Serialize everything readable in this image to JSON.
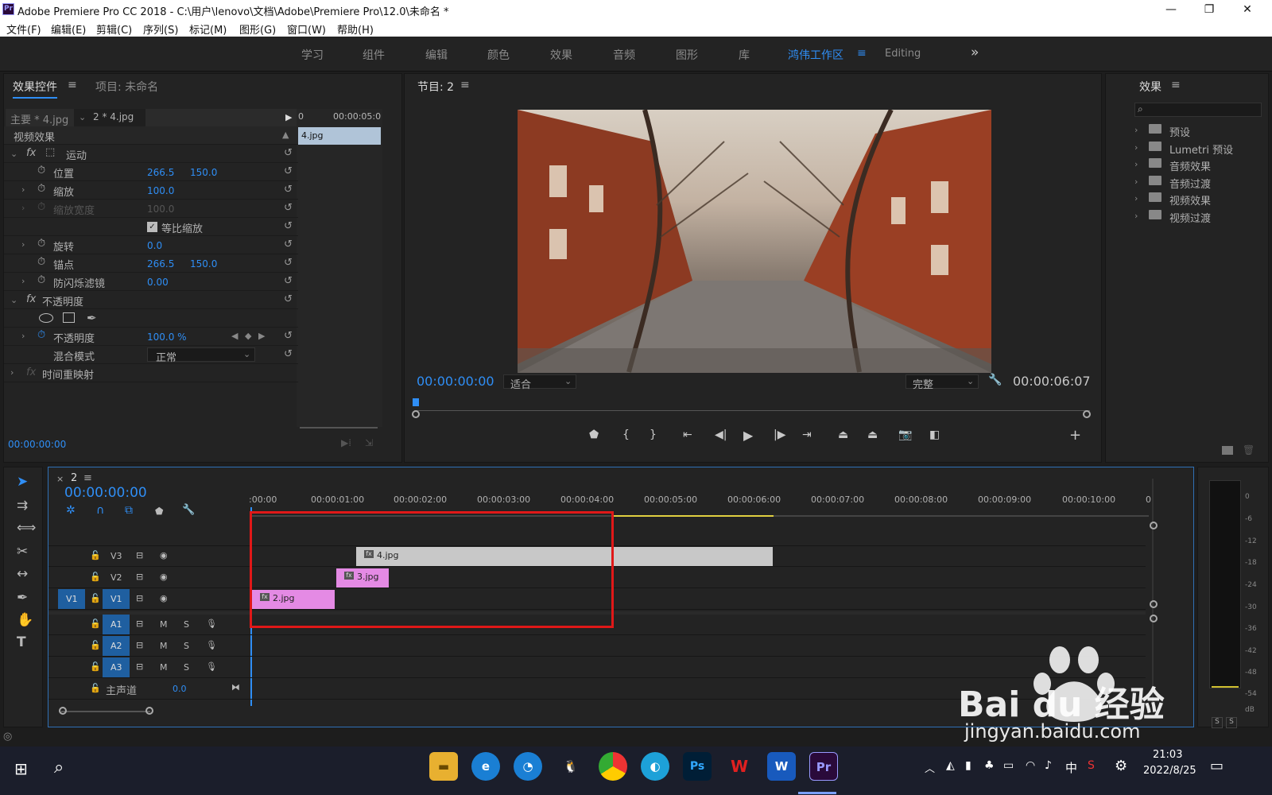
{
  "titlebar": {
    "app_icon": "Pr",
    "title": "Adobe Premiere Pro CC 2018 - C:\\用户\\lenovo\\文档\\Adobe\\Premiere Pro\\12.0\\未命名 *",
    "minimize": "—",
    "restore": "❐",
    "close": "✕"
  },
  "menu": [
    "文件(F)",
    "编辑(E)",
    "剪辑(C)",
    "序列(S)",
    "标记(M)",
    "图形(G)",
    "窗口(W)",
    "帮助(H)"
  ],
  "workspaces": [
    "学习",
    "组件",
    "编辑",
    "颜色",
    "效果",
    "音频",
    "图形",
    "库",
    "鸿伟工作区",
    "Editing"
  ],
  "workspace_active": "鸿伟工作区",
  "workspace_overflow": "»",
  "effect_controls": {
    "tab_active": "效果控件",
    "tab_menu": "≡",
    "tab_project": "项目: 未命名",
    "master": "主要 * 4.jpg",
    "clip": "2 * 4.jpg",
    "mini_time_start": "0",
    "mini_time_end": "00:00:05:0",
    "mini_clip": "4.jpg",
    "section": "视频效果",
    "motion": "运动",
    "position": "位置",
    "pos_x": "266.5",
    "pos_y": "150.0",
    "scale": "缩放",
    "scale_val": "100.0",
    "scale_width": "缩放宽度",
    "scale_width_val": "100.0",
    "uniform": "等比缩放",
    "rotation": "旋转",
    "rotation_val": "0.0",
    "anchor": "锚点",
    "anchor_x": "266.5",
    "anchor_y": "150.0",
    "flicker": "防闪烁滤镜",
    "flicker_val": "0.00",
    "opacity_fx": "不透明度",
    "opacity": "不透明度",
    "opacity_val": "100.0 %",
    "blend": "混合模式",
    "blend_val": "正常",
    "timeremap": "时间重映射",
    "fx": "fx",
    "timecode": "00:00:00:00"
  },
  "program": {
    "title": "节目: 2",
    "timecode": "00:00:00:00",
    "fit": "适合",
    "quality": "完整",
    "duration": "00:00:06:07"
  },
  "effects": {
    "title": "效果",
    "items": [
      "预设",
      "Lumetri 预设",
      "音频效果",
      "音频过渡",
      "视频效果",
      "视频过渡"
    ]
  },
  "timeline": {
    "seq_name": "2",
    "timecode": "00:00:00:00",
    "ruler": [
      ":00:00",
      "00:00:01:00",
      "00:00:02:00",
      "00:00:03:00",
      "00:00:04:00",
      "00:00:05:00",
      "00:00:06:00",
      "00:00:07:00",
      "00:00:08:00",
      "00:00:09:00",
      "00:00:10:00",
      "0"
    ],
    "tracks": [
      "V3",
      "V2",
      "V1",
      "A1",
      "A2",
      "A3"
    ],
    "source_v": "V1",
    "m": "M",
    "s": "S",
    "master": "主声道",
    "master_val": "0.0",
    "clips": [
      "4.jpg",
      "3.jpg",
      "2.jpg"
    ],
    "fx_badge": "fx"
  },
  "meter": {
    "labels": [
      "0",
      "-6",
      "-12",
      "-18",
      "-24",
      "-30",
      "-36",
      "-42",
      "-48",
      "-54",
      "dB"
    ],
    "s1": "S",
    "s2": "S"
  },
  "taskbar": {
    "apps": [
      "e",
      "Ps",
      "W",
      "W",
      "Pr"
    ],
    "clock": "21:03",
    "date": "2022/8/25",
    "ime": "中"
  },
  "watermark": {
    "brand": "Bai du 经验",
    "url": "jingyan.baidu.com"
  }
}
